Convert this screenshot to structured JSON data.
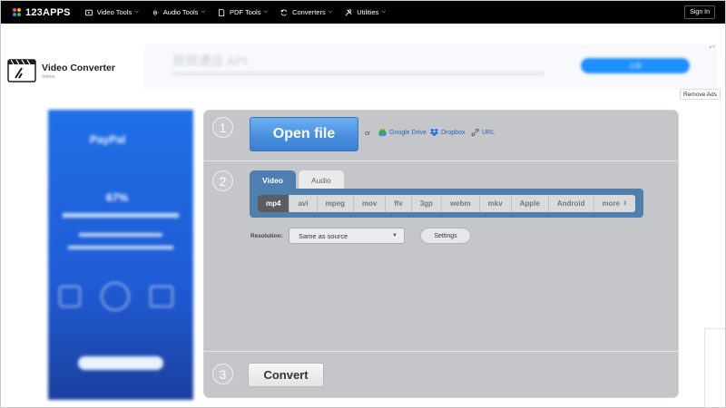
{
  "brand": {
    "name": "123APPS",
    "dot_colors": [
      "#ff4d4d",
      "#ffb400",
      "#2d8cff",
      "#21c16b"
    ]
  },
  "nav": {
    "items": [
      {
        "label": "Video Tools",
        "icon": "video-icon"
      },
      {
        "label": "Audio Tools",
        "icon": "audio-wave-icon"
      },
      {
        "label": "PDF Tools",
        "icon": "pdf-icon"
      },
      {
        "label": "Converters",
        "icon": "convert-icon"
      },
      {
        "label": "Utilities",
        "icon": "utilities-icon"
      }
    ],
    "signin_label": "Sign In"
  },
  "app": {
    "title": "Video Converter",
    "subtitle": "online",
    "icon": "video-converter-icon"
  },
  "top_ad": {
    "title": "视频通话 API",
    "button": "立即"
  },
  "remove_ads_label": "Remove Ads",
  "left_ad": {
    "brand": "PayPal",
    "percent": "67%"
  },
  "steps": [
    "1",
    "2",
    "3"
  ],
  "step1": {
    "open_file_label": "Open file",
    "or_label": "or",
    "sources": [
      {
        "label": "Google Drive",
        "icon": "google-drive-icon",
        "color": "#34a853"
      },
      {
        "label": "Dropbox",
        "icon": "dropbox-icon",
        "color": "#0061fe"
      },
      {
        "label": "URL",
        "icon": "link-icon",
        "color": "#555555"
      }
    ]
  },
  "step2": {
    "tabs": [
      "Video",
      "Audio"
    ],
    "active_tab": "Video",
    "formats": [
      "mp4",
      "avi",
      "mpeg",
      "mov",
      "flv",
      "3gp",
      "webm",
      "mkv",
      "Apple",
      "Android",
      "more"
    ],
    "selected_format": "mp4",
    "resolution_label": "Resolution:",
    "resolution_value": "Same as source",
    "settings_label": "Settings"
  },
  "step3": {
    "convert_label": "Convert"
  },
  "colors": {
    "accent_blue": "#4a8fdf",
    "tab_active": "#4e7fb0",
    "panel": "#c4c6ca"
  }
}
